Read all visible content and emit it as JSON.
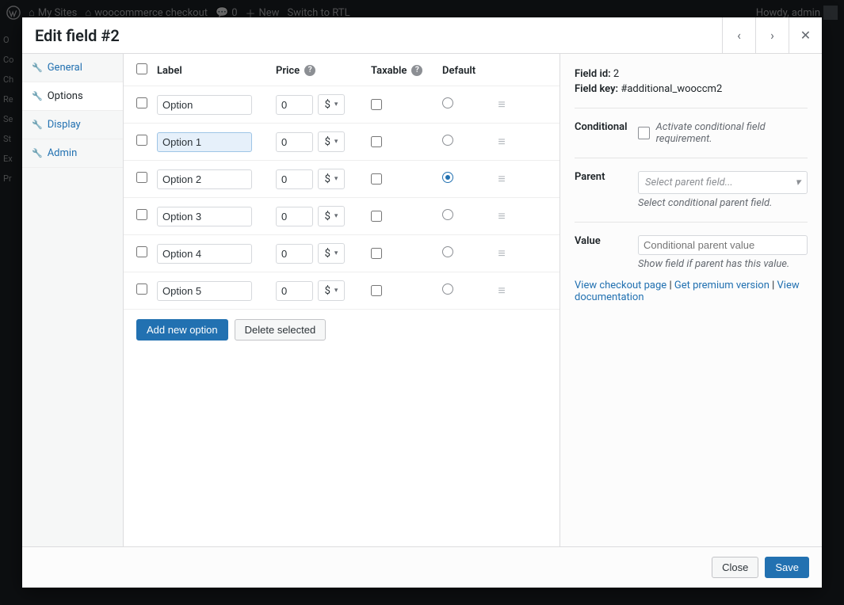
{
  "adminbar": {
    "my_sites": "My Sites",
    "site_name": "woocommerce checkout",
    "comments": "0",
    "new": "New",
    "switch_rtl": "Switch to RTL",
    "howdy": "Howdy, admin"
  },
  "modal": {
    "title": "Edit field #2",
    "close_label": "Close",
    "save_label": "Save"
  },
  "tabs": {
    "general": "General",
    "options": "Options",
    "display": "Display",
    "admin": "Admin"
  },
  "table": {
    "head_label": "Label",
    "head_price": "Price",
    "head_taxable": "Taxable",
    "head_default": "Default",
    "currency": "$",
    "rows": [
      {
        "label": "Option",
        "price": "0",
        "taxable": false,
        "default": false,
        "highlight": false
      },
      {
        "label": "Option 1",
        "price": "0",
        "taxable": false,
        "default": false,
        "highlight": true
      },
      {
        "label": "Option 2",
        "price": "0",
        "taxable": false,
        "default": true,
        "highlight": false
      },
      {
        "label": "Option 3",
        "price": "0",
        "taxable": false,
        "default": false,
        "highlight": false
      },
      {
        "label": "Option 4",
        "price": "0",
        "taxable": false,
        "default": false,
        "highlight": false
      },
      {
        "label": "Option 5",
        "price": "0",
        "taxable": false,
        "default": false,
        "highlight": false
      }
    ],
    "add_label": "Add new option",
    "delete_label": "Delete selected"
  },
  "side": {
    "field_id_label": "Field id:",
    "field_id_value": "2",
    "field_key_label": "Field key:",
    "field_key_value": "#additional_wooccm2",
    "conditional_label": "Conditional",
    "conditional_text": "Activate conditional field requirement.",
    "parent_label": "Parent",
    "parent_placeholder": "Select parent field...",
    "parent_help": "Select conditional parent field.",
    "value_label": "Value",
    "value_placeholder": "Conditional parent value",
    "value_help": "Show field if parent has this value.",
    "link_checkout": "View checkout page",
    "link_premium": "Get premium version",
    "link_docs": "View documentation"
  }
}
